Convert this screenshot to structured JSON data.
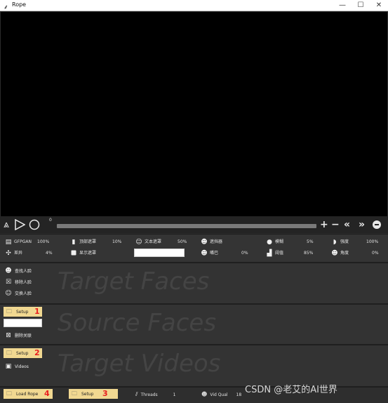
{
  "window": {
    "title": "Rope",
    "minimize": "—",
    "maximize": "☐",
    "close": "✕"
  },
  "playbar": {
    "frame_number": "0",
    "icons": [
      "up-chevrons-icon",
      "play-icon",
      "record-icon",
      "plus-icon",
      "minus-icon",
      "rewind-icon",
      "fast-forward-icon",
      "stop-icon"
    ]
  },
  "params": {
    "row1": [
      {
        "label": "GFPGAN",
        "value": "100%",
        "icon": "gfpgan-icon"
      },
      {
        "label": "顶部遮罩",
        "value": "10%",
        "icon": "top-mask-icon"
      },
      {
        "label": "文本遮罩",
        "value": "50%",
        "icon": "text-mask-icon"
      },
      {
        "label": "遮挡器",
        "value": "",
        "icon": "occluder-icon"
      },
      {
        "label": "模糊",
        "value": "5%",
        "icon": "blur-icon"
      },
      {
        "label": "强度",
        "value": "100%",
        "icon": "strength-icon"
      }
    ],
    "row2": [
      {
        "label": "差异",
        "value": "4%",
        "icon": "diff-icon"
      },
      {
        "label": "显示遮罩",
        "value": "",
        "icon": "show-mask-checkbox"
      },
      {
        "label": "嘴巴",
        "value": "0%",
        "icon": "mouth-icon"
      },
      {
        "label": "阈值",
        "value": "85%",
        "icon": "threshold-icon"
      },
      {
        "label": "角度",
        "value": "0%",
        "icon": "angle-icon"
      }
    ]
  },
  "target_faces": {
    "heading": "Target Faces",
    "items": [
      {
        "label": "查找人脸",
        "icon": "find-faces-icon"
      },
      {
        "label": "移除人脸",
        "icon": "remove-faces-icon"
      },
      {
        "label": "交换人脸",
        "icon": "swap-faces-icon"
      }
    ]
  },
  "source_faces": {
    "heading": "Source Faces",
    "setup_label": "Setup",
    "annotation": "1",
    "clear_label": "删除关联"
  },
  "target_videos": {
    "heading": "Target Videos",
    "setup_label": "Setup",
    "annotation": "2",
    "videos_label": "Videos"
  },
  "bottom": {
    "load_rope_label": "Load Rope",
    "load_rope_annotation": "4",
    "setup_label": "Setup",
    "setup_annotation": "3",
    "threads_label": "Threads",
    "threads_value": "1",
    "vid_qual_label": "Vid Qual",
    "vid_qual_value": "18"
  },
  "watermark": "CSDN @老艾的AI世界",
  "colors": {
    "background": "#2b2b2b",
    "panel": "#333333",
    "setup_button": "#f1d891",
    "annotation": "#e82020"
  }
}
